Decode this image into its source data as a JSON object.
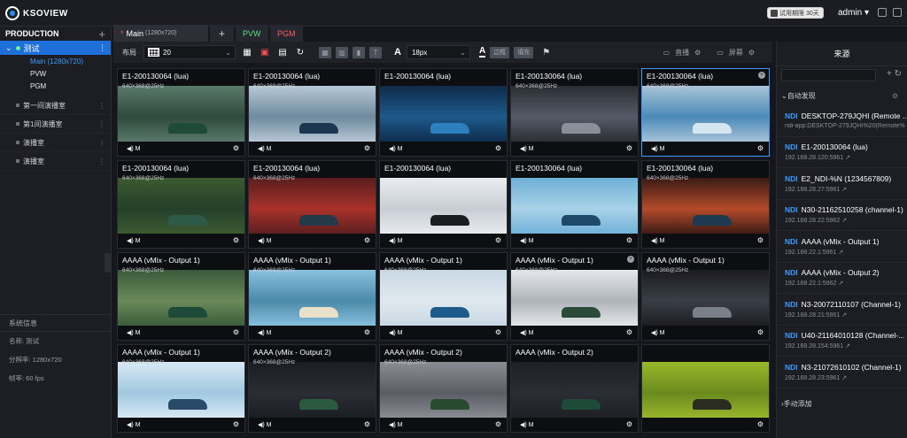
{
  "app": {
    "logo_text": "KSOVIEW",
    "trial": "试用期限 30天",
    "user": "admin"
  },
  "left": {
    "title": "PRODUCTION",
    "active_item": "测试",
    "subitems": [
      "Main (1280x720)",
      "PVW",
      "PGM"
    ],
    "groups": [
      "第一间演播室",
      "第1间演播室",
      "演播室",
      "演播室"
    ],
    "sys_title": "系统信息",
    "sys_lines": [
      "名称: 测试",
      "分辨率: 1280x720",
      "帧率: 60 fps"
    ]
  },
  "tabs": {
    "main": "Main",
    "main_res": "(1280x720)",
    "plus": "+",
    "pvw": "PVW",
    "pgm": "PGM"
  },
  "toolbar": {
    "layout_label": "布局",
    "layout_value": "20",
    "font_size": "18px",
    "border_label": "边框",
    "align_label": "填充",
    "live_label": "直播",
    "screen_label": "屏幕"
  },
  "cells": [
    {
      "title": "E1-200130064 (lua)",
      "res": "640×368@25Hz",
      "audio": "M",
      "colors": [
        "#5a7a6a",
        "#2f4a3c",
        "#1e4a3a"
      ]
    },
    {
      "title": "E1-200130064 (lua)",
      "res": "640×368@25Hz",
      "audio": "M",
      "colors": [
        "#b8c8d6",
        "#6e8a9e",
        "#1c3550"
      ]
    },
    {
      "title": "E1-200130064 (lua)",
      "res": "",
      "audio": "M",
      "colors": [
        "#0e2a4a",
        "#1d5a8a",
        "#2d7fc0"
      ]
    },
    {
      "title": "E1-200130064 (lua)",
      "res": "640×368@25Hz",
      "audio": "M",
      "colors": [
        "#2a2d33",
        "#555b66",
        "#8a9099"
      ]
    },
    {
      "title": "E1-200130064 (lua)",
      "res": "640×368@25Hz",
      "audio": "M",
      "colors": [
        "#a9c4d8",
        "#4a8ab8",
        "#d6e6f0"
      ]
    },
    {
      "title": "E1-200130064 (lua)",
      "res": "640×368@25Hz",
      "audio": "M",
      "colors": [
        "#3c5a30",
        "#24402a",
        "#2d5a48"
      ]
    },
    {
      "title": "E1-200130064 (lua)",
      "res": "640×368@25Hz",
      "audio": "M",
      "colors": [
        "#5a1e1e",
        "#a8322a",
        "#233a4a"
      ]
    },
    {
      "title": "E1-200130064 (lua)",
      "res": "",
      "audio": "M",
      "colors": [
        "#e8ecef",
        "#c8ced4",
        "#1a1c20"
      ]
    },
    {
      "title": "E1-200130064 (lua)",
      "res": "",
      "audio": "M",
      "colors": [
        "#6fb0d8",
        "#a8d2e8",
        "#1e4a6a"
      ]
    },
    {
      "title": "E1-200130064 (lua)",
      "res": "640×368@25Hz",
      "audio": "M",
      "colors": [
        "#3a1a14",
        "#b44a2a",
        "#1e3a50"
      ]
    },
    {
      "title": "AAAA (vMix - Output 1)",
      "res": "640×368@25Hz",
      "audio": "M",
      "colors": [
        "#3a5a3a",
        "#6a8a5a",
        "#1e4a3a"
      ]
    },
    {
      "title": "AAAA (vMix - Output 1)",
      "res": "640×368@25Hz",
      "audio": "M",
      "colors": [
        "#8ac0e0",
        "#4a8aa8",
        "#e8e0c8"
      ]
    },
    {
      "title": "AAAA (vMix - Output 1)",
      "res": "640×368@25Hz",
      "audio": "M",
      "colors": [
        "#c8d8e4",
        "#e0e8ee",
        "#1e5a8a"
      ]
    },
    {
      "title": "AAAA (vMix - Output 1)",
      "res": "640×368@25Hz",
      "audio": "M",
      "colors": [
        "#e6e8ea",
        "#aeb4ba",
        "#2a4a3a"
      ]
    },
    {
      "title": "AAAA (vMix - Output 1)",
      "res": "640×368@25Hz",
      "audio": "M",
      "colors": [
        "#1a1c20",
        "#3a3e46",
        "#7a8088"
      ]
    },
    {
      "title": "AAAA (vMix - Output 1)",
      "res": "640×368@25Hz",
      "audio": "M",
      "colors": [
        "#d8e8f4",
        "#a0c8e0",
        "#2a4a6a"
      ]
    },
    {
      "title": "AAAA (vMix - Output 2)",
      "res": "640×368@25Hz",
      "audio": "M",
      "colors": [
        "#1a1d22",
        "#2a2e34",
        "#2a5a40"
      ]
    },
    {
      "title": "AAAA (vMix - Output 2)",
      "res": "640×368@25Hz",
      "audio": "M",
      "colors": [
        "#8a8e94",
        "#5a5e64",
        "#2a4a30"
      ]
    },
    {
      "title": "AAAA (vMix - Output 2)",
      "res": "",
      "audio": "M",
      "colors": [
        "#1e2024",
        "#2a2d33",
        "#1e4a3a"
      ]
    },
    {
      "title": "",
      "res": "",
      "audio": "",
      "colors": [
        "#9ab82a",
        "#6a8a1e",
        "#2a2c22"
      ]
    }
  ],
  "right": {
    "title": "来源",
    "search_placeholder": "",
    "auto_section": "自动发现",
    "manual_section": "手动添加",
    "sources": [
      {
        "tag": "NDI",
        "name": "DESKTOP-279JQHI (Remote ...",
        "ip": "ndi-app:DESKTOP-279JQHI%20(Remote%"
      },
      {
        "tag": "NDI",
        "name": "E1-200130064 (lua)",
        "ip": "192.168.28.120:5961"
      },
      {
        "tag": "NDI",
        "name": "E2_NDI-%N (1234567809)",
        "ip": "192.168.28.27:5961"
      },
      {
        "tag": "NDI",
        "name": "N30-21162510258 (channel-1)",
        "ip": "192.168.28.22:5962"
      },
      {
        "tag": "NDI",
        "name": "AAAA (vMix - Output 1)",
        "ip": "192.168.22.1:5961"
      },
      {
        "tag": "NDI",
        "name": "AAAA (vMix - Output 2)",
        "ip": "192.168.22.1:5962"
      },
      {
        "tag": "NDI",
        "name": "N3-20072110107 (Channel-1)",
        "ip": "192.168.28.21:5961"
      },
      {
        "tag": "NDI",
        "name": "U40-21164010128 (Channel-...",
        "ip": "192.168.28.154:5961"
      },
      {
        "tag": "NDI",
        "name": "N3-21072610102 (Channel-1)",
        "ip": "192.168.28.23:5961"
      }
    ]
  }
}
